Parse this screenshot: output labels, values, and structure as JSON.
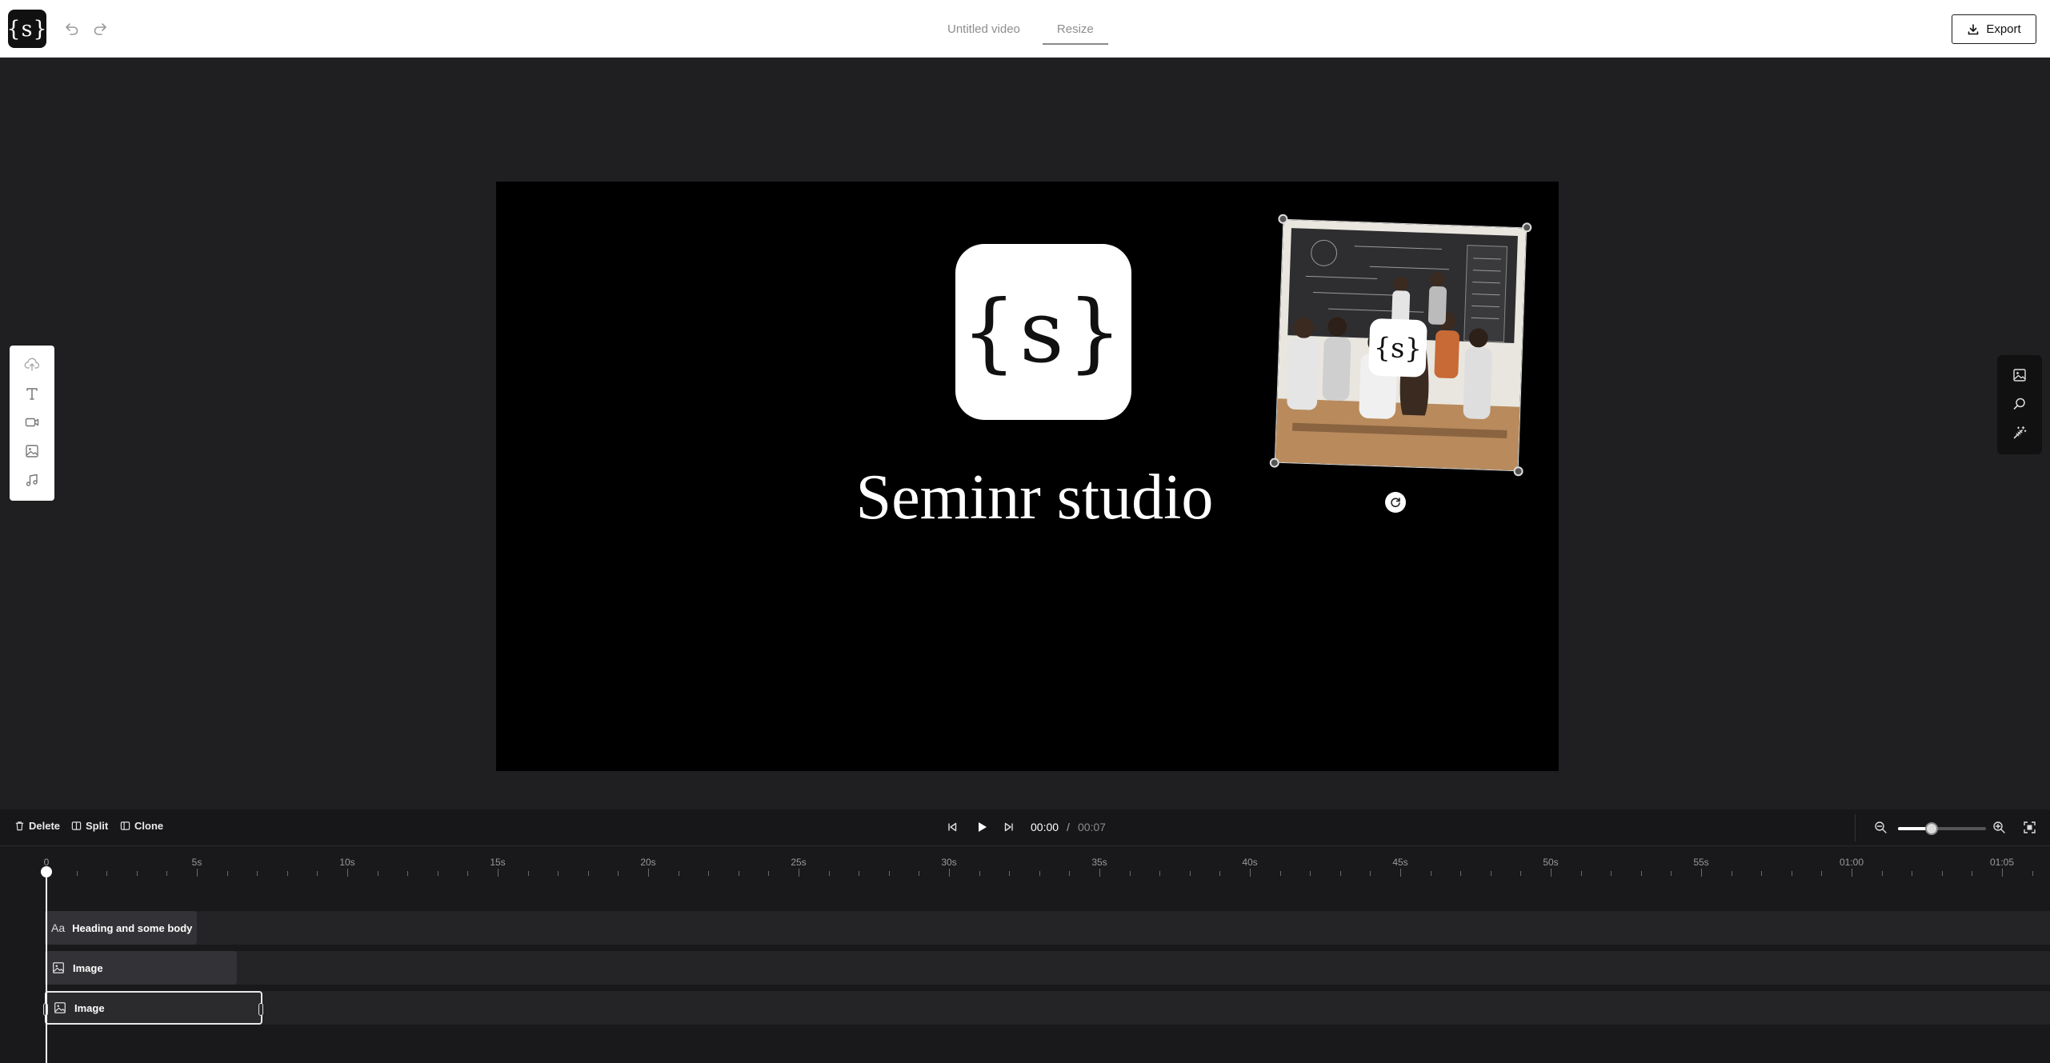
{
  "app": {
    "logo_text": "{s}",
    "undo_icon": "undo-icon",
    "redo_icon": "redo-icon",
    "title": "Untitled video",
    "resize_tab": "Resize",
    "export_label": "Export"
  },
  "canvas": {
    "logo_text": "{s}",
    "headline": "Seminr studio",
    "photo_logo_text": "{s}",
    "background": "#000000"
  },
  "left_toolbar": [
    "upload-icon",
    "text-icon",
    "video-icon",
    "image-icon",
    "music-icon"
  ],
  "right_toolbar": [
    "image-icon",
    "search-icon",
    "magic-wand-icon"
  ],
  "timeline_controls": {
    "delete_label": "Delete",
    "split_label": "Split",
    "clone_label": "Clone",
    "current_time": "00:00",
    "separator": "/",
    "duration": "00:07",
    "zoom_level": 0.38
  },
  "ruler": [
    "0",
    "5s",
    "10s",
    "15s",
    "20s",
    "25s",
    "30s",
    "35s",
    "40s",
    "45s",
    "50s",
    "55s",
    "01:00",
    "01:05"
  ],
  "tracks": [
    {
      "icon": "text-aa-icon",
      "label": "Heading and some body",
      "selected": false
    },
    {
      "icon": "image-icon",
      "label": "Image",
      "selected": false
    },
    {
      "icon": "image-icon",
      "label": "Image",
      "selected": true
    }
  ],
  "colors": {
    "accent": "#ffffff",
    "panel": "#1f1f21",
    "track": "#242427",
    "clip": "#333337"
  }
}
